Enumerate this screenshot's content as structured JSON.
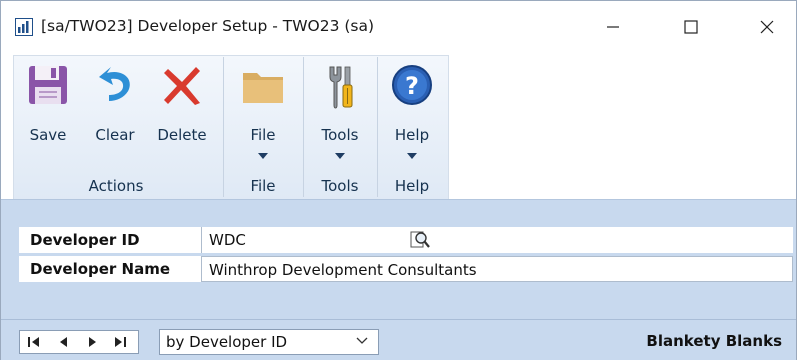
{
  "window": {
    "title": "[sa/TWO23] Developer Setup  -  TWO23 (sa)",
    "minimize_icon": "minimize-icon",
    "maximize_icon": "maximize-icon",
    "close_icon": "close-icon"
  },
  "ribbon": {
    "buttons": {
      "save": {
        "label": "Save",
        "icon": "floppy-disk-icon"
      },
      "clear": {
        "label": "Clear",
        "icon": "undo-arrow-icon"
      },
      "delete": {
        "label": "Delete",
        "icon": "red-x-icon"
      },
      "file": {
        "label": "File",
        "icon": "folder-icon"
      },
      "tools": {
        "label": "Tools",
        "icon": "wrench-screwdriver-icon"
      },
      "help": {
        "label": "Help",
        "icon": "help-question-icon"
      }
    },
    "groups": {
      "actions": "Actions",
      "file": "File",
      "tools": "Tools",
      "help": "Help"
    }
  },
  "form": {
    "developer_id": {
      "label": "Developer ID",
      "value": "WDC",
      "lookup_icon": "lookup-magnifier-icon"
    },
    "developer_name": {
      "label": "Developer Name",
      "value": "Winthrop Development Consultants"
    }
  },
  "bottom": {
    "nav_icons": [
      "first-record-icon",
      "previous-record-icon",
      "next-record-icon",
      "last-record-icon"
    ],
    "sort_by": "by Developer ID",
    "status": "Blankety Blanks"
  },
  "colors": {
    "content_bg": "#c8d9ee",
    "ribbon_text": "#16324f",
    "delete_red": "#d93a2e",
    "help_blue": "#2a5fb3"
  }
}
